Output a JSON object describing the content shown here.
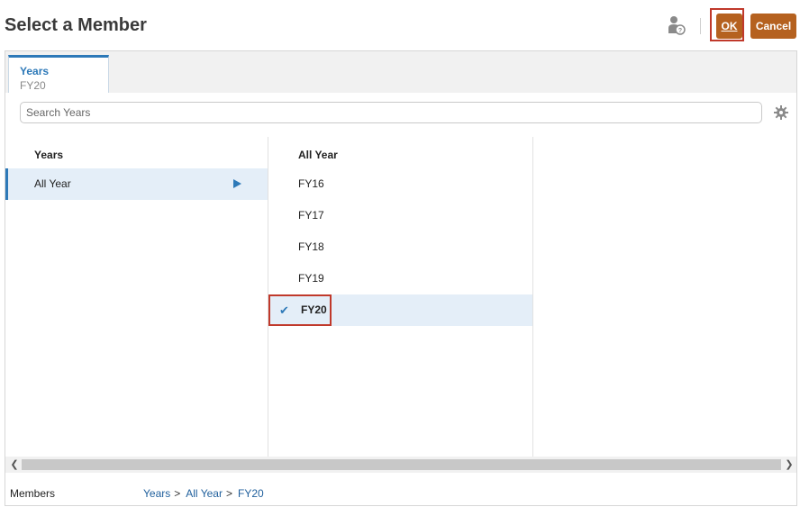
{
  "header": {
    "title": "Select a Member",
    "ok_label": "OK",
    "cancel_label": "Cancel"
  },
  "tab": {
    "title": "Years",
    "subtitle": "FY20"
  },
  "search": {
    "placeholder": "Search Years"
  },
  "columns": [
    {
      "header": "Years",
      "items": [
        {
          "label": "All Year",
          "selected": true
        }
      ]
    },
    {
      "header": "All Year",
      "items": [
        {
          "label": "FY16"
        },
        {
          "label": "FY17"
        },
        {
          "label": "FY18"
        },
        {
          "label": "FY19"
        },
        {
          "label": "FY20",
          "selected": true
        }
      ]
    }
  ],
  "footer": {
    "label": "Members",
    "breadcrumb": [
      "Years",
      "All Year",
      "FY20"
    ],
    "separator": ">"
  },
  "colors": {
    "accent": "#2d79b8",
    "button": "#b5611f",
    "highlight": "#e4eef8",
    "focus_frame": "#c0392b"
  }
}
